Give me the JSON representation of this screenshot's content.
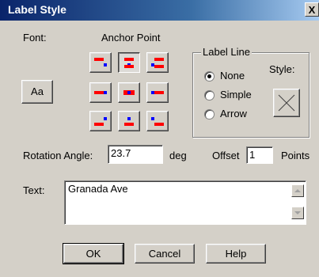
{
  "window": {
    "title": "Label Style",
    "close_glyph": "X"
  },
  "labels": {
    "font": "Font:",
    "anchor_point": "Anchor Point",
    "label_line": "Label Line",
    "style": "Style:",
    "rotation_angle": "Rotation Angle:",
    "deg": "deg",
    "offset": "Offset",
    "points": "Points",
    "text": "Text:"
  },
  "font_button": {
    "label": "Aa"
  },
  "anchor_grid": {
    "selected": "top-center",
    "cells": [
      "top-left",
      "top-center",
      "top-right",
      "middle-left",
      "center",
      "middle-right",
      "bottom-left",
      "bottom-center",
      "bottom-right"
    ]
  },
  "label_line": {
    "options": [
      "None",
      "Simple",
      "Arrow"
    ],
    "selected": "None"
  },
  "style_button": {
    "icon": "x-cross-icon"
  },
  "rotation_angle": {
    "value": "23.7"
  },
  "offset": {
    "value": "1"
  },
  "text": {
    "value": "Granada Ave"
  },
  "buttons": {
    "ok": "OK",
    "cancel": "Cancel",
    "help": "Help"
  },
  "colors": {
    "title_bar": "#0a246a",
    "dialog_bg": "#d4d0c8",
    "marker_red": "#ff0000",
    "marker_blue": "#0000ff"
  }
}
